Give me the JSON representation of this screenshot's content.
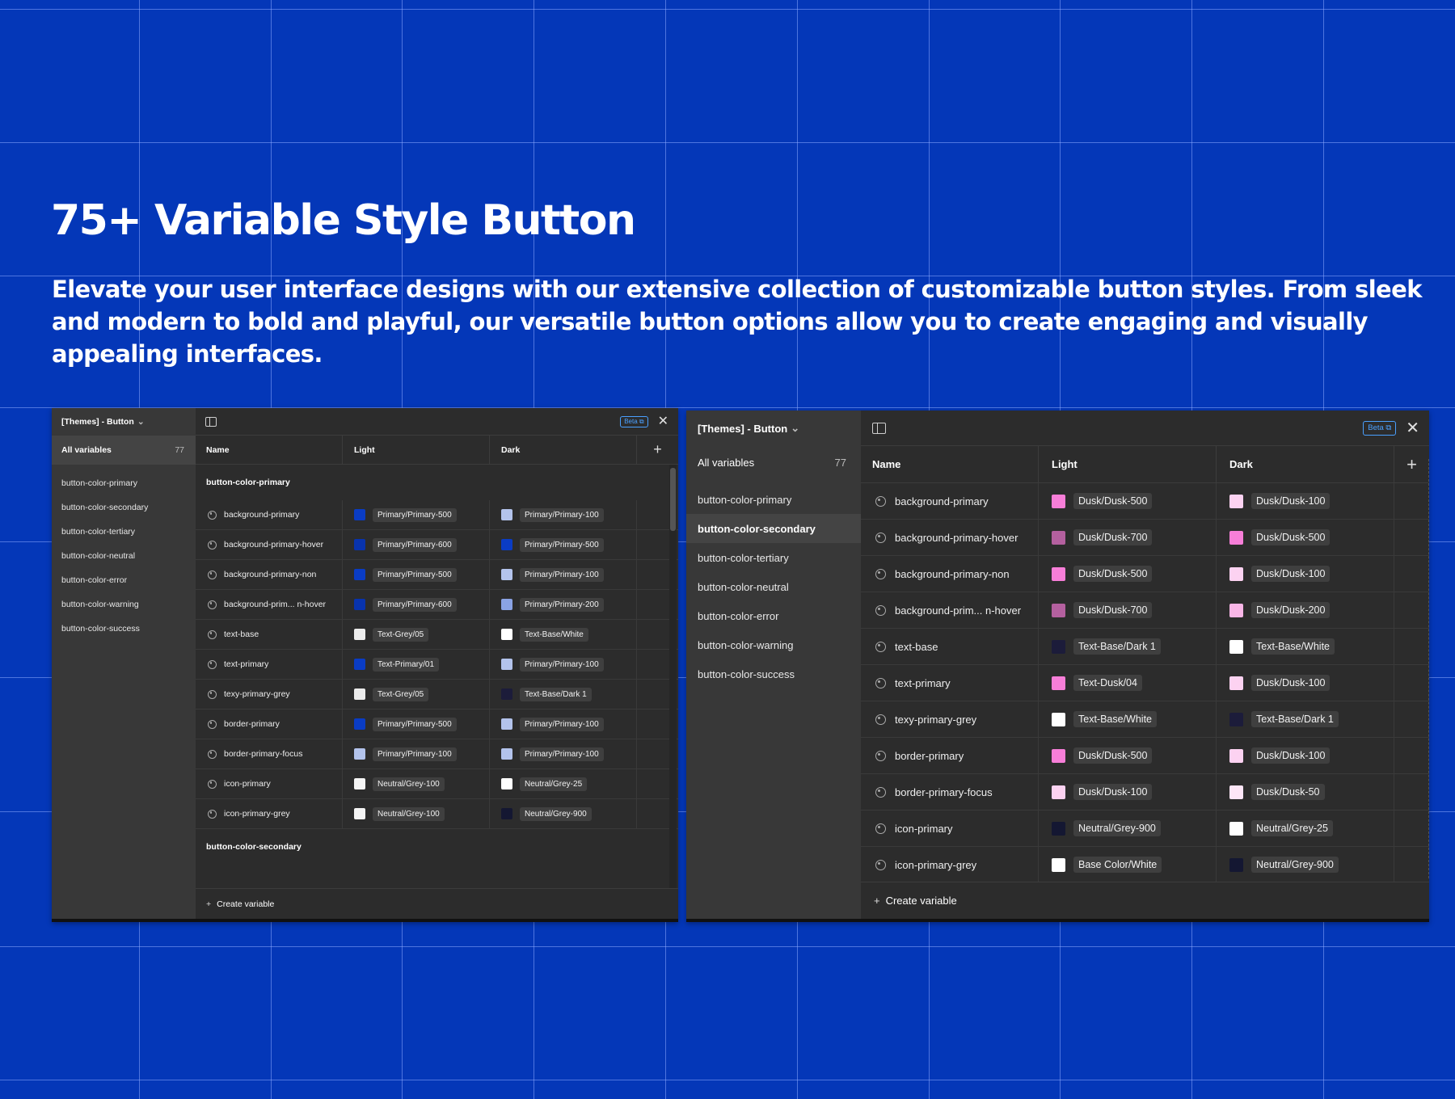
{
  "hero": {
    "title": "75+ Variable Style Button",
    "subtitle": "Elevate your user interface designs with our extensive collection of customizable button styles. From sleek and modern to bold and playful, our versatile button options allow you to create engaging and visually appealing interfaces."
  },
  "colors": {
    "background": "#0437b8",
    "panel": "#2c2c2c",
    "sidebar": "#383838",
    "accent_beta": "#4aa0ff",
    "primary_500": "#0a3cc4",
    "primary_600": "#0833ad",
    "primary_100": "#b3c3ec",
    "primary_200": "#8aa3e4",
    "dusk_500": "#f77ed8",
    "dusk_700": "#b4609f",
    "dusk_100": "#fcd2f1",
    "dusk_200": "#f9b6e7",
    "dusk_50": "#fde6f7",
    "white": "#ffffff",
    "grey_05": "#ececec",
    "dark_1": "#1c1c3a",
    "grey_900": "#141732"
  },
  "panel1": {
    "collection": "[Themes] - Button",
    "all_variables": "All variables",
    "count": "77",
    "beta": "Beta",
    "columns": {
      "name": "Name",
      "light": "Light",
      "dark": "Dark"
    },
    "sidebar_items": [
      "button-color-primary",
      "button-color-secondary",
      "button-color-tertiary",
      "button-color-neutral",
      "button-color-error",
      "button-color-warning",
      "button-color-success"
    ],
    "group1": "button-color-primary",
    "group2": "button-color-secondary",
    "rows": [
      {
        "name": "background-primary",
        "light": "Primary/Primary-500",
        "light_color": "#0a3cc4",
        "dark": "Primary/Primary-100",
        "dark_color": "#b3c3ec"
      },
      {
        "name": "background-primary-hover",
        "light": "Primary/Primary-600",
        "light_color": "#0833ad",
        "dark": "Primary/Primary-500",
        "dark_color": "#0a3cc4"
      },
      {
        "name": "background-primary-non",
        "light": "Primary/Primary-500",
        "light_color": "#0a3cc4",
        "dark": "Primary/Primary-100",
        "dark_color": "#b3c3ec"
      },
      {
        "name": "background-prim... n-hover",
        "light": "Primary/Primary-600",
        "light_color": "#0833ad",
        "dark": "Primary/Primary-200",
        "dark_color": "#8aa3e4"
      },
      {
        "name": "text-base",
        "light": "Text-Grey/05",
        "light_color": "#ececec",
        "dark": "Text-Base/White",
        "dark_color": "#ffffff"
      },
      {
        "name": "text-primary",
        "light": "Text-Primary/01",
        "light_color": "#0a3cc4",
        "dark": "Primary/Primary-100",
        "dark_color": "#b3c3ec"
      },
      {
        "name": "texy-primary-grey",
        "light": "Text-Grey/05",
        "light_color": "#ececec",
        "dark": "Text-Base/Dark 1",
        "dark_color": "#1c1c3a"
      },
      {
        "name": "border-primary",
        "light": "Primary/Primary-500",
        "light_color": "#0a3cc4",
        "dark": "Primary/Primary-100",
        "dark_color": "#b3c3ec"
      },
      {
        "name": "border-primary-focus",
        "light": "Primary/Primary-100",
        "light_color": "#b3c3ec",
        "dark": "Primary/Primary-100",
        "dark_color": "#b3c3ec"
      },
      {
        "name": "icon-primary",
        "light": "Neutral/Grey-100",
        "light_color": "#f5f5f5",
        "dark": "Neutral/Grey-25",
        "dark_color": "#ffffff"
      },
      {
        "name": "icon-primary-grey",
        "light": "Neutral/Grey-100",
        "light_color": "#f5f5f5",
        "dark": "Neutral/Grey-900",
        "dark_color": "#141732"
      }
    ],
    "create": "Create variable"
  },
  "panel2": {
    "collection": "[Themes] - Button",
    "all_variables": "All variables",
    "count": "77",
    "beta": "Beta",
    "columns": {
      "name": "Name",
      "light": "Light",
      "dark": "Dark"
    },
    "sidebar_items": [
      "button-color-primary",
      "button-color-secondary",
      "button-color-tertiary",
      "button-color-neutral",
      "button-color-error",
      "button-color-warning",
      "button-color-success"
    ],
    "active_item": "button-color-secondary",
    "rows": [
      {
        "name": "background-primary",
        "light": "Dusk/Dusk-500",
        "light_color": "#f77ed8",
        "dark": "Dusk/Dusk-100",
        "dark_color": "#fcd2f1"
      },
      {
        "name": "background-primary-hover",
        "light": "Dusk/Dusk-700",
        "light_color": "#b4609f",
        "dark": "Dusk/Dusk-500",
        "dark_color": "#f77ed8"
      },
      {
        "name": "background-primary-non",
        "light": "Dusk/Dusk-500",
        "light_color": "#f77ed8",
        "dark": "Dusk/Dusk-100",
        "dark_color": "#fcd2f1"
      },
      {
        "name": "background-prim... n-hover",
        "light": "Dusk/Dusk-700",
        "light_color": "#b4609f",
        "dark": "Dusk/Dusk-200",
        "dark_color": "#f9b6e7"
      },
      {
        "name": "text-base",
        "light": "Text-Base/Dark 1",
        "light_color": "#1c1c3a",
        "dark": "Text-Base/White",
        "dark_color": "#ffffff"
      },
      {
        "name": "text-primary",
        "light": "Text-Dusk/04",
        "light_color": "#f77ed8",
        "dark": "Dusk/Dusk-100",
        "dark_color": "#fcd2f1"
      },
      {
        "name": "texy-primary-grey",
        "light": "Text-Base/White",
        "light_color": "#ffffff",
        "dark": "Text-Base/Dark 1",
        "dark_color": "#1c1c3a"
      },
      {
        "name": "border-primary",
        "light": "Dusk/Dusk-500",
        "light_color": "#f77ed8",
        "dark": "Dusk/Dusk-100",
        "dark_color": "#fcd2f1"
      },
      {
        "name": "border-primary-focus",
        "light": "Dusk/Dusk-100",
        "light_color": "#fcd2f1",
        "dark": "Dusk/Dusk-50",
        "dark_color": "#fde6f7"
      },
      {
        "name": "icon-primary",
        "light": "Neutral/Grey-900",
        "light_color": "#141732",
        "dark": "Neutral/Grey-25",
        "dark_color": "#ffffff"
      },
      {
        "name": "icon-primary-grey",
        "light": "Base Color/White",
        "light_color": "#ffffff",
        "dark": "Neutral/Grey-900",
        "dark_color": "#141732"
      }
    ],
    "create": "Create variable"
  }
}
